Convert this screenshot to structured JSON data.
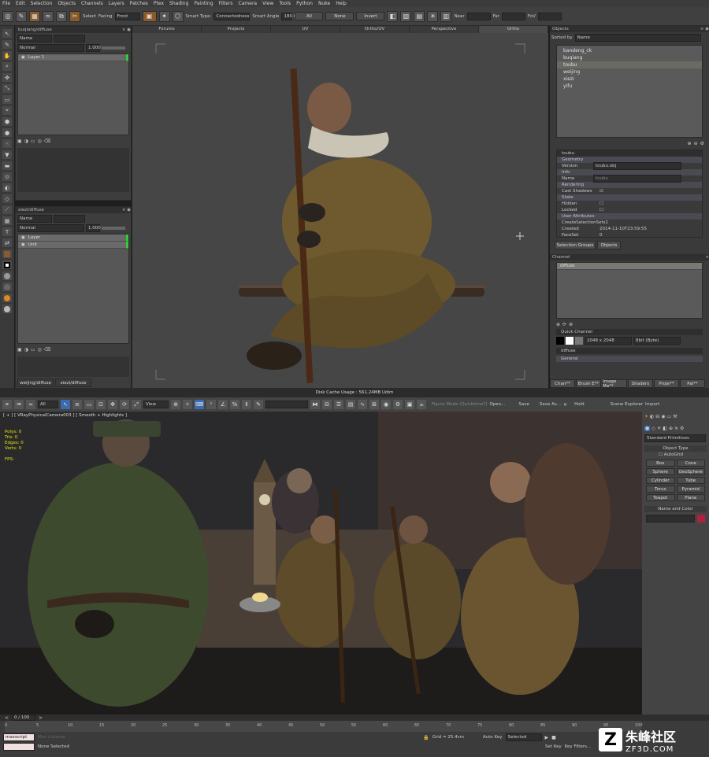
{
  "menu": [
    "File",
    "Edit",
    "Selection",
    "Objects",
    "Channels",
    "Layers",
    "Patches",
    "Ptex",
    "Shading",
    "Painting",
    "Filters",
    "Camera",
    "View",
    "Tools",
    "Python",
    "Nuke",
    "Help"
  ],
  "toolbar": {
    "select_label": "Select",
    "facing_label": "Facing",
    "facing_value": "Front",
    "smart_type_label": "Smart Type:",
    "smart_type_value": "Connectedness",
    "smart_angle_label": "Smart Angle",
    "smart_angle_value": "180.0",
    "all_btn": "All",
    "none_btn": "None",
    "invert_btn": "Invert",
    "near_label": "Near",
    "far_label": "Far",
    "fov_label": "FoV"
  },
  "left_top_panel": {
    "title": "buqiang/diffuse",
    "search_value": "Name",
    "blend_mode": "Normal",
    "opacity": "1.000",
    "layers": [
      "Layer 1"
    ]
  },
  "left_bottom_panel": {
    "title": "xiezi/diffuse",
    "search_value": "Name",
    "blend_mode": "Normal",
    "opacity": "1.000",
    "layers": [
      "Layer",
      "Unit"
    ],
    "tabs": [
      "weijing/diffuse",
      "xiezi/diffuse"
    ]
  },
  "viewport_tabs": [
    "Forums",
    "Projects",
    "UV",
    "Ortho/UV",
    "Perspective",
    "Ortho"
  ],
  "objects_panel": {
    "title": "Objects",
    "sorted_by_label": "Sorted by",
    "sorted_by_value": "Name",
    "items": [
      "bandeng_ck",
      "buqiang",
      "toubu",
      "weijing",
      "xiezi",
      "yifu"
    ],
    "selected": "toubu"
  },
  "properties": {
    "name": "toubu",
    "geometry": "Geometry",
    "version_label": "Version",
    "version_value": "toubu.obj",
    "info": "Info",
    "name_label": "Name",
    "name_value": "toubu",
    "rendering": "Rendering",
    "cast_shadows": "Cast Shadows",
    "state": "State",
    "hidden": "Hidden",
    "locked": "Locked",
    "user_attributes": "User Attributes",
    "create_sel": "CreateSelectionSets1",
    "created_label": "Created",
    "created_value": "2014-11-10T23:59:55",
    "faces_label": "FaceSet",
    "faces_value": "0",
    "tabs": [
      "Selection Groups",
      "Objects"
    ]
  },
  "channel_panel": {
    "title": "Channel",
    "item": "diffuse",
    "quick_channel": "Quick Channel",
    "size": "2048 x 2048",
    "depth": "8bit (Byte)",
    "diffuse": "diffuse",
    "general": "General",
    "bottom_tabs": [
      "Chan**",
      "Brush E**",
      "Image Ma**",
      "Shaders",
      "Proje**",
      "Pal**"
    ]
  },
  "status": {
    "disk_cache": "Disk Cache Usage : 561.24MB Udim"
  },
  "max": {
    "viewport_label": "[ + ] [ VRayPhysicalCamera003 ] [ Smooth + Highlights ]",
    "stats": [
      "Polys: 0",
      "Tris: 0",
      "Edges: 0",
      "Verts: 0",
      "",
      "FPS:"
    ],
    "dropdown_all": "All",
    "dropdown_view": "View",
    "open_label": "Open...",
    "save_label": "Save",
    "save_as_label": "Save As...",
    "hold_label": "Hold",
    "figure_mode": "Figure Mode (Quicktime?)",
    "explorer": "Scene Explorer",
    "import": "Import",
    "cmd_dropdown": "Standard Primitives",
    "object_type": "Object Type",
    "autogrid": "AutoGrid",
    "primitives": [
      "Box",
      "Cone",
      "Sphere",
      "GeoSphere",
      "Cylinder",
      "Tube",
      "Torus",
      "Pyramid",
      "Teapot",
      "Plane"
    ],
    "name_color": "Name and Color",
    "frame": "0 / 100",
    "ticks": [
      "0",
      "5",
      "10",
      "15",
      "20",
      "25",
      "30",
      "35",
      "40",
      "45",
      "50",
      "55",
      "60",
      "65",
      "70",
      "75",
      "80",
      "85",
      "90",
      "95",
      "100"
    ],
    "script_label": "maxscript",
    "status_text": "None Selected",
    "grid": "Grid = 25.4cm",
    "auto_key": "Auto Key",
    "selected": "Selected",
    "set_key": "Set Key",
    "key_filters": "Key Filters..."
  },
  "watermark": {
    "cn": "朱峰社区",
    "url": "ZF3D.COM"
  }
}
